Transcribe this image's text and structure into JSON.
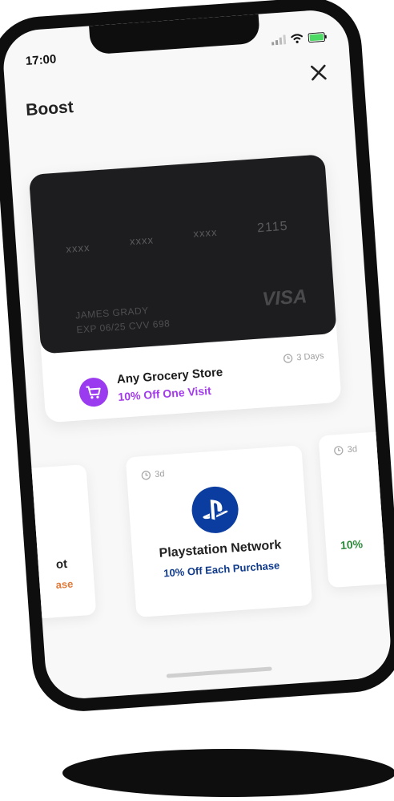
{
  "status_bar": {
    "time": "17:00"
  },
  "header": {
    "title": "Boost"
  },
  "card": {
    "mask": [
      "xxxx",
      "xxxx",
      "xxxx"
    ],
    "last4": "2115",
    "name": "JAMES GRADY",
    "exp_cvv": "EXP 06/25   CVV 698",
    "brand": "VISA"
  },
  "featured_offer": {
    "store": "Any Grocery Store",
    "offer": "10% Off One Visit",
    "days": "3 Days"
  },
  "offers": [
    {
      "name": "ot",
      "offer": "ase",
      "days": ""
    },
    {
      "name": "Playstation Network",
      "offer": "10% Off Each Purchase",
      "days": "3d"
    },
    {
      "name": "",
      "offer": "10%",
      "days": "3d"
    }
  ],
  "colors": {
    "accent_purple": "#a23bea",
    "playstation_blue": "#0f3a8c",
    "orange": "#e07a3a",
    "green": "#2c8a3a",
    "card_bg": "#1d1d1f"
  },
  "icons": {
    "close": "close-icon",
    "cart": "cart-icon",
    "clock": "clock-icon",
    "playstation": "playstation-logo-icon"
  }
}
